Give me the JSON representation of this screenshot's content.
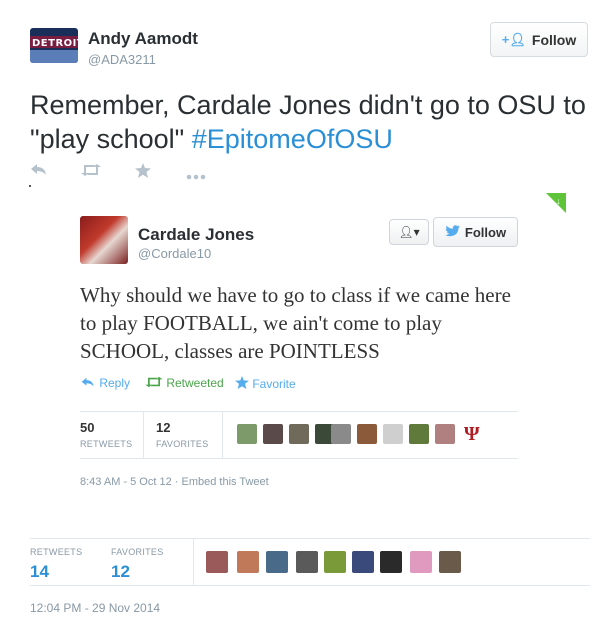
{
  "author": {
    "name": "Andy Aamodt",
    "handle": "@ADA3211",
    "avatar_text": "DETROIT"
  },
  "follow_button": {
    "label": "Follow",
    "icon": "add-user-icon"
  },
  "tweet": {
    "text_before": "Remember, Cardale Jones didn't go to OSU to \"play school\" ",
    "hashtag": "#EpitomeOfOSU"
  },
  "actions": {
    "reply_icon": "reply-icon",
    "retweet_icon": "retweet-icon",
    "favorite_icon": "star-icon",
    "more_icon": "more-icon"
  },
  "embedded": {
    "name": "Cardale Jones",
    "handle": "@Cordale10",
    "follow_label": "Follow",
    "text": "Why should we have to go to class if we came here to play FOOTBALL, we ain't come to play SCHOOL, classes are POINTLESS",
    "reply_label": "Reply",
    "retweeted_label": "Retweeted",
    "favorite_label": "Favorite",
    "retweets_count": "50",
    "retweets_label": "RETWEETS",
    "favorites_count": "12",
    "favorites_label": "FAVORITES",
    "timestamp": "8:43 AM - 5 Oct 12 · Embed this Tweet"
  },
  "stats": {
    "retweets_label": "RETWEETS",
    "retweets_count": "14",
    "favorites_label": "FAVORITES",
    "favorites_count": "12"
  },
  "timestamp": "12:04 PM - 29 Nov 2014",
  "colors": {
    "link": "#2b8fd6",
    "retweet_green": "#4aa54a",
    "muted": "#8899a6"
  }
}
